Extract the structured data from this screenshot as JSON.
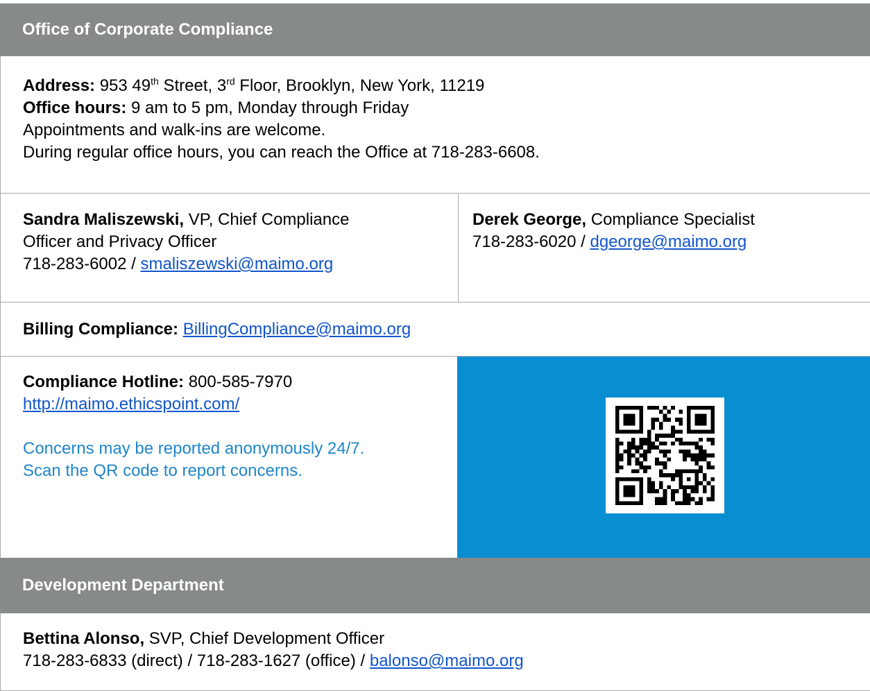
{
  "compliance": {
    "header": "Office of Corporate Compliance",
    "address_label": "Address:",
    "address_num1": " 953 49",
    "address_sup1": "th",
    "address_mid": " Street, 3",
    "address_sup2": "rd",
    "address_rest": " Floor, Brooklyn, New York, 11219",
    "hours_label": "Office hours:",
    "hours_value": " 9 am to 5 pm, Monday through Friday",
    "appointments": "Appointments and walk-ins are welcome.",
    "reach": "During regular office hours, you can reach the Office at 718-283-6608."
  },
  "people": {
    "left": {
      "name": "Sandra Maliszewski,",
      "title_line1": " VP, Chief Compliance",
      "title_line2": "Officer and Privacy Officer",
      "phone": "718-283-6002 / ",
      "email": "smaliszewski@maimo.org"
    },
    "right": {
      "name": "Derek George,",
      "title": " Compliance Specialist",
      "phone": "718-283-6020 / ",
      "email": "dgeorge@maimo.org"
    }
  },
  "billing": {
    "label": "Billing Compliance:",
    "email": "BillingCompliance@maimo.org"
  },
  "hotline": {
    "label": "Compliance Hotline:",
    "phone": " 800-585-7970",
    "url": "http://maimo.ethicspoint.com/",
    "note_line1": "Concerns may be reported anonymously 24/7.",
    "note_line2": "Scan the QR code to report concerns."
  },
  "development": {
    "header": "Development Department",
    "name": "Bettina Alonso,",
    "title": " SVP, Chief Development Officer",
    "phones": "718-283-6833 (direct) / 718-283-1627 (office) / ",
    "email": "balonso@maimo.org"
  },
  "colors": {
    "header_bg": "#868a8b",
    "qr_panel_bg": "#0a8ed2",
    "note_text": "#1f86c7",
    "link": "#1155cc"
  }
}
